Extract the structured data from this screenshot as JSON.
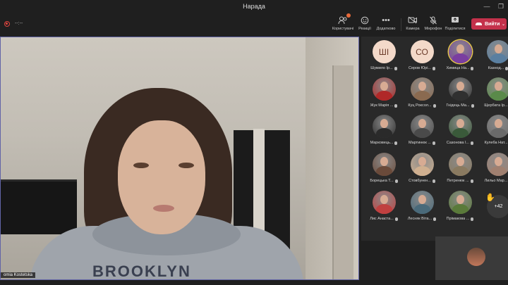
{
  "window": {
    "title": "Нарада"
  },
  "toolbar": {
    "timer": "--:--",
    "tools": [
      {
        "id": "participants",
        "label": "Користувачі",
        "icon": "people-icon",
        "badge": true
      },
      {
        "id": "reactions",
        "label": "Реакції",
        "icon": "reaction-icon"
      },
      {
        "id": "more",
        "label": "Додатково",
        "icon": "more-icon"
      },
      {
        "id": "camera",
        "label": "Камера",
        "icon": "camera-off-icon"
      },
      {
        "id": "mic",
        "label": "Мікрофон",
        "icon": "mic-off-icon"
      },
      {
        "id": "share",
        "label": "Поділитися",
        "icon": "share-icon"
      }
    ],
    "leave_label": "Вийти"
  },
  "stage": {
    "speaker_name": "omia Kostetska",
    "hoodie_text": "BROOKLYN"
  },
  "participants": [
    {
      "name": "Шумило Ір...",
      "initials": "ШІ",
      "type": "initials"
    },
    {
      "name": "Серов Юрі...",
      "initials": "СО",
      "type": "initials"
    },
    {
      "name": "Химица На...",
      "type": "photo",
      "color": "#7a3ea0",
      "highlight": true
    },
    {
      "name": "Казнод...",
      "type": "photo",
      "color": "#5a7fa0"
    },
    {
      "name": "Жук Марія ...",
      "type": "photo",
      "color": "#b02828"
    },
    {
      "name": "Куц Роксол...",
      "type": "photo",
      "color": "#8a6a50"
    },
    {
      "name": "Гнідець Ма...",
      "type": "photo",
      "color": "#303030"
    },
    {
      "name": "Щербата Ір...",
      "type": "photo",
      "color": "#5a8a4a"
    },
    {
      "name": "Марковець...",
      "type": "photo",
      "color": "#2a2a2a"
    },
    {
      "name": "Мартинюк ...",
      "type": "photo",
      "color": "#4a4a4a"
    },
    {
      "name": "Сазонова І...",
      "type": "photo",
      "color": "#3a5a3a"
    },
    {
      "name": "Кулеба Нат...",
      "type": "photo",
      "color": "#6a6a6a"
    },
    {
      "name": "Борецька Т...",
      "type": "photo",
      "color": "#6a4a3a"
    },
    {
      "name": "Стовбунен...",
      "type": "photo",
      "color": "#d0b090"
    },
    {
      "name": "Петренюк ...",
      "type": "photo",
      "color": "#8a7a60"
    },
    {
      "name": "Лильо Мар...",
      "type": "photo",
      "color": "#a08070"
    },
    {
      "name": "Лис Анаста...",
      "type": "photo",
      "color": "#c04040"
    },
    {
      "name": "Лесняк Віта...",
      "type": "photo",
      "color": "#4a6a7a"
    },
    {
      "name": "Прімакова ...",
      "type": "photo",
      "color": "#5a7a3a"
    }
  ],
  "overflow": {
    "count": "+42"
  }
}
